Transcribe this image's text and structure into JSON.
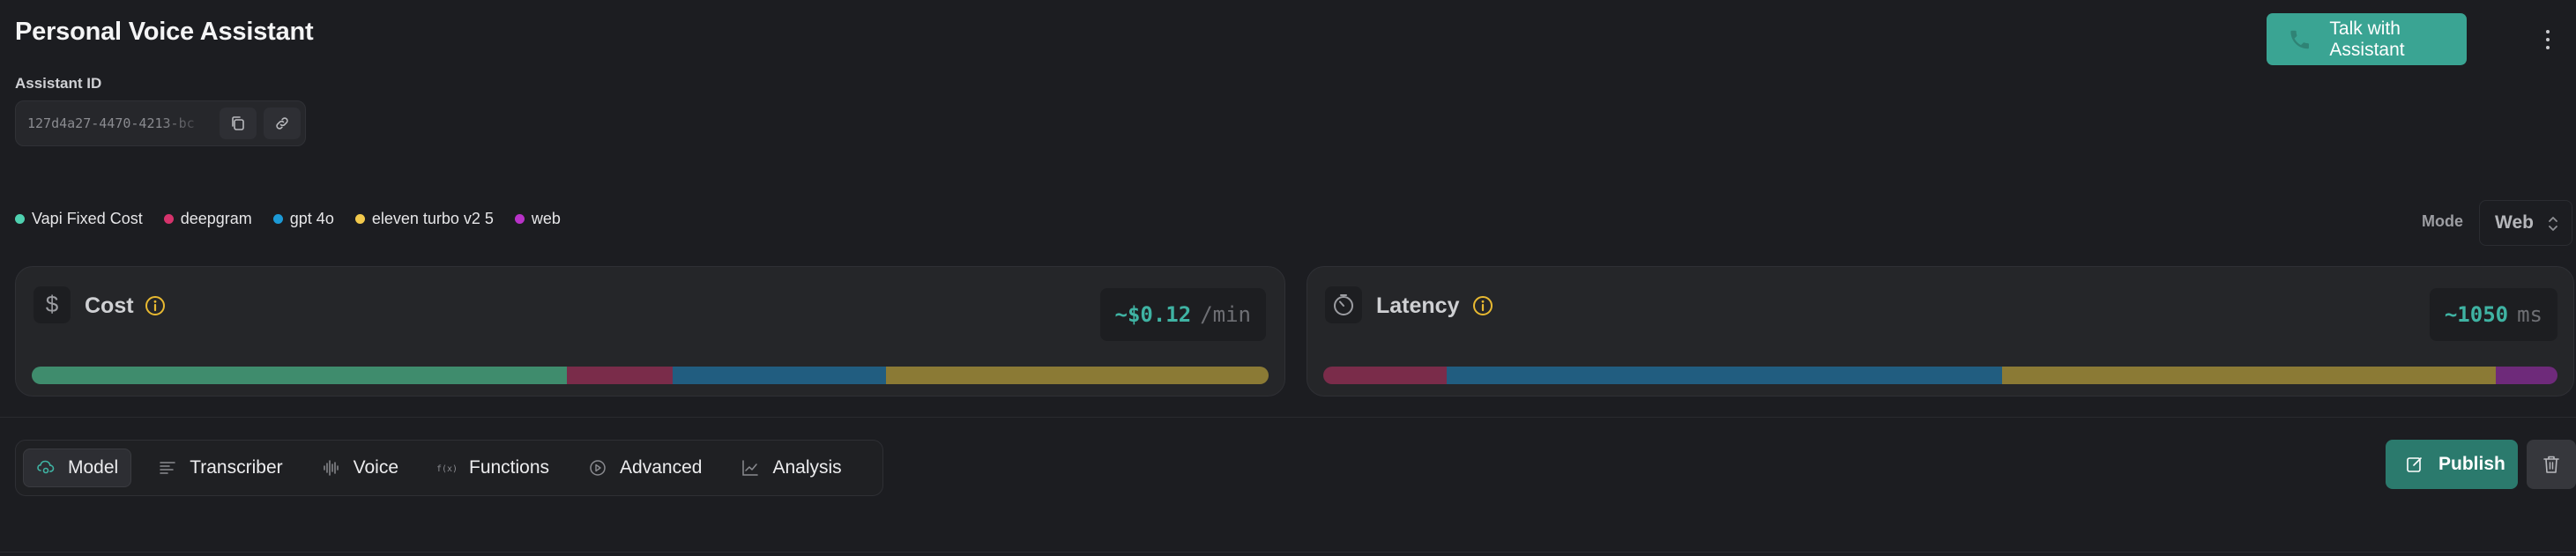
{
  "header": {
    "title": "Personal Voice Assistant",
    "talk_button": "Talk with Assistant"
  },
  "assistant": {
    "id_label": "Assistant ID",
    "id_value": "127d4a27-4470-4213-bc"
  },
  "legend": [
    {
      "label": "Vapi Fixed Cost",
      "color": "#4fd1b0"
    },
    {
      "label": "deepgram",
      "color": "#d6336c"
    },
    {
      "label": "gpt 4o",
      "color": "#1c9ad6"
    },
    {
      "label": "eleven turbo v2 5",
      "color": "#f2c94c"
    },
    {
      "label": "web",
      "color": "#b832c8"
    }
  ],
  "mode": {
    "label": "Mode",
    "value": "Web"
  },
  "cost": {
    "title": "Cost",
    "value": "~$0.12",
    "unit": "/min",
    "segments": [
      {
        "name": "Vapi Fixed Cost",
        "share": 43.3,
        "color": "#3f8c6d"
      },
      {
        "name": "deepgram",
        "share": 8.5,
        "color": "#7a2c4a"
      },
      {
        "name": "gpt 4o",
        "share": 17.3,
        "color": "#215d80"
      },
      {
        "name": "eleven turbo v2 5",
        "share": 30.9,
        "color": "#8b7a35"
      }
    ]
  },
  "latency": {
    "title": "Latency",
    "value": "~1050",
    "unit": "ms",
    "segments": [
      {
        "name": "deepgram",
        "share": 10,
        "color": "#7a2c4a"
      },
      {
        "name": "gpt 4o",
        "share": 45,
        "color": "#215d80"
      },
      {
        "name": "eleven turbo v2 5",
        "share": 40,
        "color": "#8b7a35"
      },
      {
        "name": "web",
        "share": 5,
        "color": "#6e2a7a"
      }
    ]
  },
  "tabs": [
    {
      "label": "Model",
      "icon": "model-icon",
      "active": true
    },
    {
      "label": "Transcriber",
      "icon": "transcriber-icon",
      "active": false
    },
    {
      "label": "Voice",
      "icon": "voice-icon",
      "active": false
    },
    {
      "label": "Functions",
      "icon": "functions-icon",
      "active": false
    },
    {
      "label": "Advanced",
      "icon": "advanced-icon",
      "active": false
    },
    {
      "label": "Analysis",
      "icon": "analysis-icon",
      "active": false
    }
  ],
  "actions": {
    "publish": "Publish"
  },
  "colors": {
    "accent": "#3aa493",
    "publish": "#2b7a6d",
    "value_text": "#3fb3a3",
    "info": "#e8b931"
  }
}
